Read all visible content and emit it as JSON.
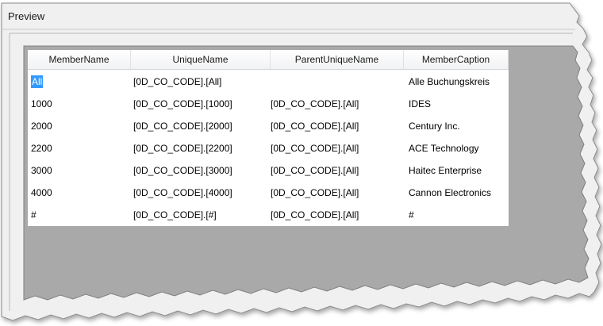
{
  "window": {
    "title": "Preview"
  },
  "grid": {
    "columns": [
      "MemberName",
      "UniqueName",
      "ParentUniqueName",
      "MemberCaption"
    ],
    "rows": [
      [
        "All",
        "[0D_CO_CODE].[All]",
        "",
        "Alle Buchungskreis"
      ],
      [
        "1000",
        "[0D_CO_CODE].[1000]",
        "[0D_CO_CODE].[All]",
        "IDES"
      ],
      [
        "2000",
        "[0D_CO_CODE].[2000]",
        "[0D_CO_CODE].[All]",
        "Century Inc."
      ],
      [
        "2200",
        "[0D_CO_CODE].[2200]",
        "[0D_CO_CODE].[All]",
        "ACE Technology"
      ],
      [
        "3000",
        "[0D_CO_CODE].[3000]",
        "[0D_CO_CODE].[All]",
        "Haitec Enterprise"
      ],
      [
        "4000",
        "[0D_CO_CODE].[4000]",
        "[0D_CO_CODE].[All]",
        "Cannon Electronics"
      ],
      [
        "#",
        "[0D_CO_CODE].[#]",
        "[0D_CO_CODE].[All]",
        "#"
      ]
    ],
    "selected_row": 0
  },
  "colors": {
    "window_bg": "#f0f0f0",
    "panel_gray": "#a8a8a8",
    "selection": "#3399ff",
    "border": "#9a9a9a"
  }
}
